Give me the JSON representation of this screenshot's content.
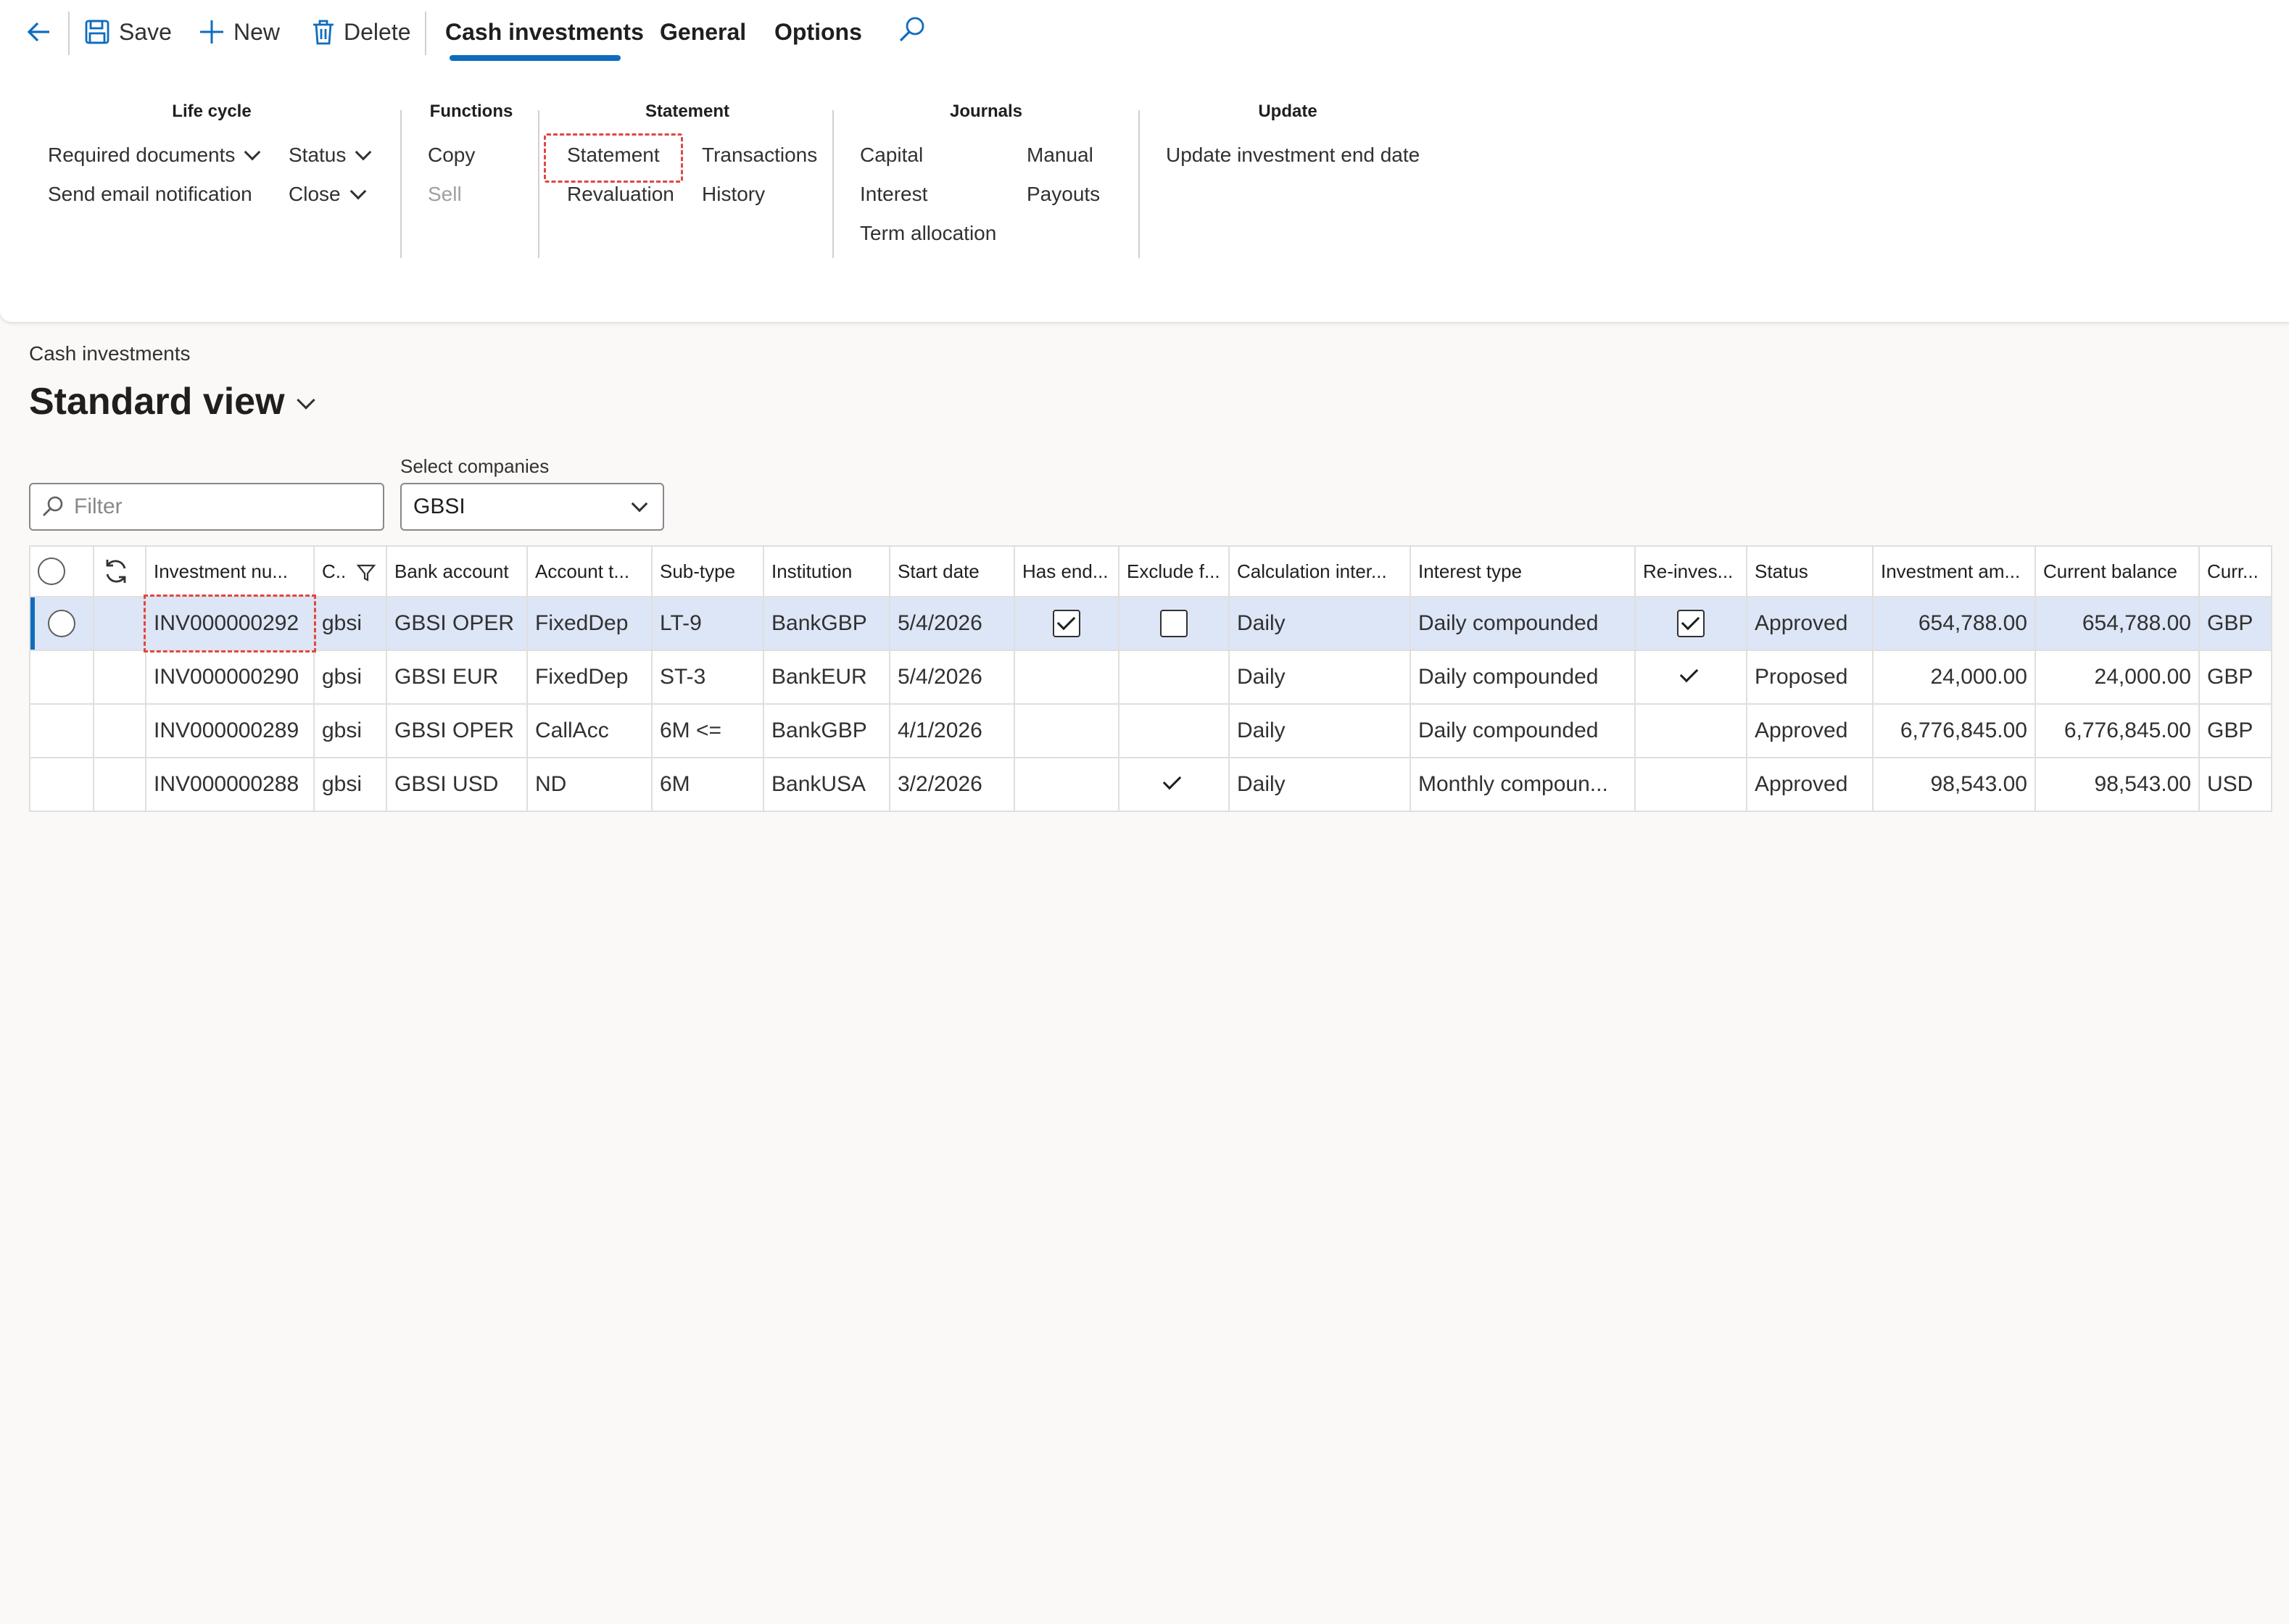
{
  "toolbar": {
    "save_label": "Save",
    "new_label": "New",
    "delete_label": "Delete",
    "tabs": [
      "Cash investments",
      "General",
      "Options"
    ],
    "active_tab": "Cash investments",
    "icons": {
      "back": "back-arrow-icon",
      "save": "save-icon",
      "new": "plus-icon",
      "delete": "trash-icon",
      "search": "search-icon"
    },
    "accent_color": "#0f6cbd"
  },
  "ribbon": {
    "lifecycle": {
      "title": "Life cycle",
      "required_documents": "Required documents",
      "send_email": "Send email notification",
      "status": "Status",
      "close": "Close"
    },
    "functions": {
      "title": "Functions",
      "copy": "Copy",
      "sell": "Sell"
    },
    "statement": {
      "title": "Statement",
      "statement": "Statement",
      "transactions": "Transactions",
      "revaluation": "Revaluation",
      "history": "History"
    },
    "journals": {
      "title": "Journals",
      "capital": "Capital",
      "manual": "Manual",
      "interest": "Interest",
      "payouts": "Payouts",
      "term_allocation": "Term allocation"
    },
    "update": {
      "title": "Update",
      "update_end_date": "Update investment end date"
    }
  },
  "page": {
    "breadcrumb": "Cash investments",
    "view_title": "Standard view",
    "filter_placeholder": "Filter",
    "select_companies_label": "Select companies",
    "select_companies_value": "GBSI"
  },
  "grid": {
    "columns": [
      "Investment nu...",
      "C..",
      "Bank account",
      "Account t...",
      "Sub-type",
      "Institution",
      "Start date",
      "Has end...",
      "Exclude f...",
      "Calculation inter...",
      "Interest type",
      "Re-inves...",
      "Status",
      "Investment am...",
      "Current balance",
      "Curr..."
    ],
    "rows": [
      {
        "investment": "INV000000292",
        "company": "gbsi",
        "bank_account": "GBSI OPER",
        "account_type": "FixedDep",
        "sub_type": "LT-9",
        "institution": "BankGBP",
        "start_date": "5/4/2026",
        "has_end": "checked-box",
        "exclude": "empty-box",
        "calc": "Daily",
        "interest_type": "Daily compounded",
        "reinvest": "checked-box",
        "status": "Approved",
        "amount": "654,788.00",
        "balance": "654,788.00",
        "currency": "GBP",
        "selected": true
      },
      {
        "investment": "INV000000290",
        "company": "gbsi",
        "bank_account": "GBSI EUR",
        "account_type": "FixedDep",
        "sub_type": "ST-3",
        "institution": "BankEUR",
        "start_date": "5/4/2026",
        "has_end": "",
        "exclude": "",
        "calc": "Daily",
        "interest_type": "Daily compounded",
        "reinvest": "tick",
        "status": "Proposed",
        "amount": "24,000.00",
        "balance": "24,000.00",
        "currency": "GBP",
        "selected": false
      },
      {
        "investment": "INV000000289",
        "company": "gbsi",
        "bank_account": "GBSI OPER",
        "account_type": "CallAcc",
        "sub_type": "6M <=",
        "institution": "BankGBP",
        "start_date": "4/1/2026",
        "has_end": "",
        "exclude": "",
        "calc": "Daily",
        "interest_type": "Daily compounded",
        "reinvest": "",
        "status": "Approved",
        "amount": "6,776,845.00",
        "balance": "6,776,845.00",
        "currency": "GBP",
        "selected": false
      },
      {
        "investment": "INV000000288",
        "company": "gbsi",
        "bank_account": "GBSI USD",
        "account_type": "ND",
        "sub_type": "6M",
        "institution": "BankUSA",
        "start_date": "3/2/2026",
        "has_end": "",
        "exclude": "tick",
        "calc": "Daily",
        "interest_type": "Monthly compoun...",
        "reinvest": "",
        "status": "Approved",
        "amount": "98,543.00",
        "balance": "98,543.00",
        "currency": "USD",
        "selected": false
      }
    ]
  }
}
